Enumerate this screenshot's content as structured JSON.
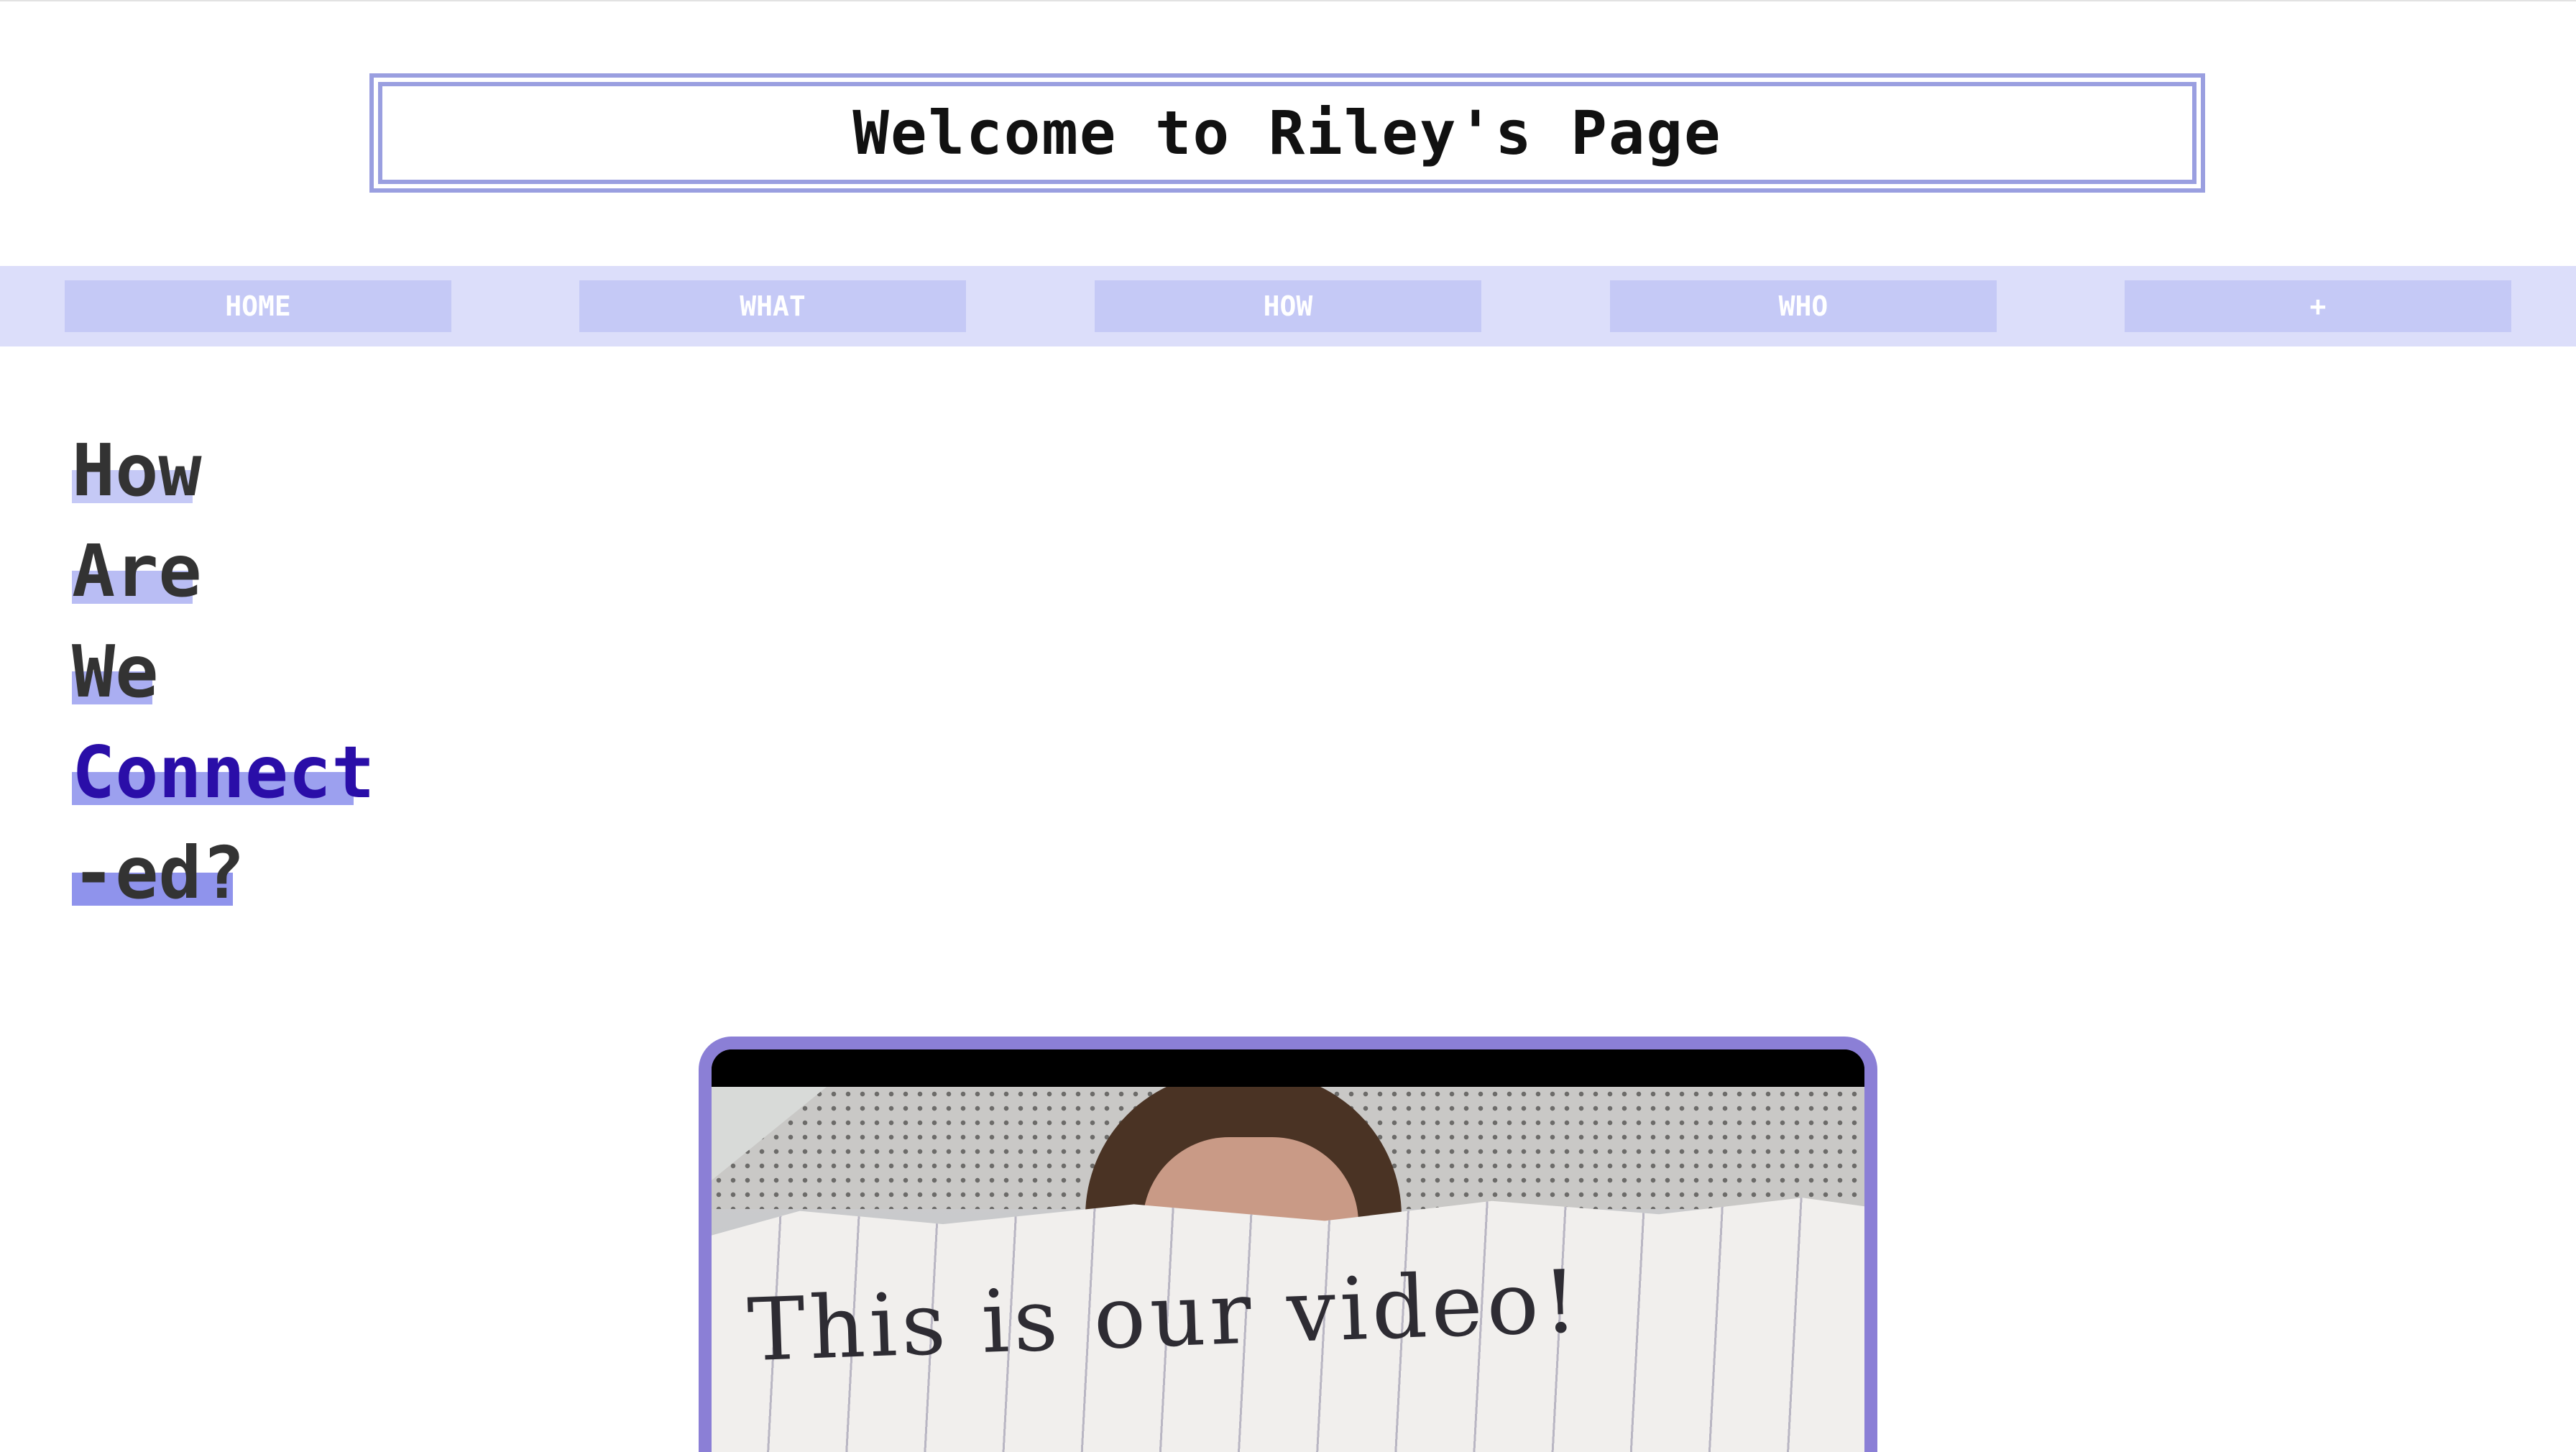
{
  "page": {
    "title": "Welcome to Riley's Page"
  },
  "nav": {
    "items": [
      {
        "label": "HOME"
      },
      {
        "label": "WHAT"
      },
      {
        "label": "HOW"
      },
      {
        "label": "WHO"
      },
      {
        "label": "+"
      }
    ]
  },
  "heading": {
    "words": [
      {
        "text": "How",
        "highlight": "#c5c9f6"
      },
      {
        "text": "Are",
        "highlight": "#b9bdf4"
      },
      {
        "text": "We",
        "highlight": "#aaaef2"
      },
      {
        "text": "Connect",
        "highlight": "#9ca0ef"
      },
      {
        "text": "-ed?",
        "highlight": "#8f93ec"
      }
    ],
    "accent_color": "#2a0ea8"
  },
  "video": {
    "note_text": "This is our video!",
    "frame_color": "#8b7fd6"
  },
  "colors": {
    "title_border": "#9a9fe0",
    "nav_bar": "#dcdefa",
    "nav_button": "#c5c9f6"
  }
}
